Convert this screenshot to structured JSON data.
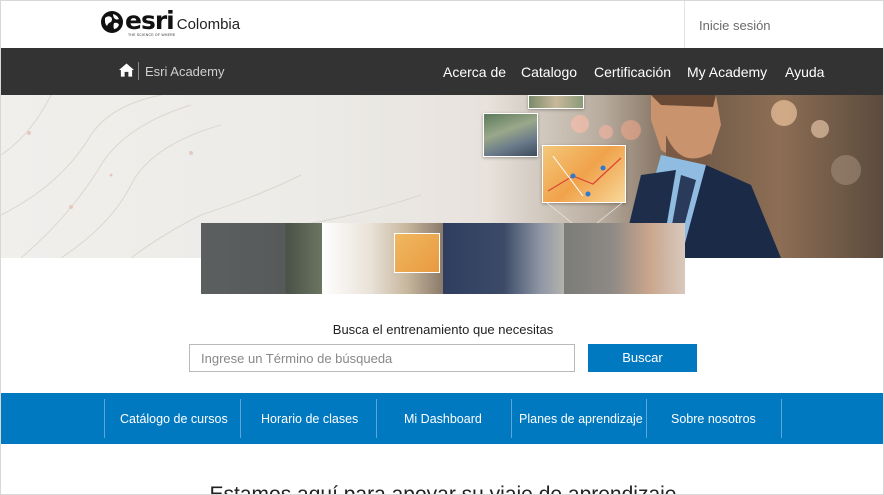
{
  "brand": {
    "logo_word": "esri",
    "logo_tagline": "THE SCIENCE OF WHERE",
    "country": "Colombia",
    "login": "Inicie sesión"
  },
  "topnav": {
    "academy_label": "Esri Academy",
    "items": [
      {
        "label": "Acerca de"
      },
      {
        "label": "Catalogo"
      },
      {
        "label": "Certificación"
      },
      {
        "label": "My Academy"
      },
      {
        "label": "Ayuda"
      }
    ]
  },
  "search": {
    "title": "Busca el entrenamiento que necesitas",
    "placeholder": "Ingrese un Término de búsqueda",
    "button": "Buscar"
  },
  "subnav": {
    "items": [
      {
        "label": "Catálogo de cursos"
      },
      {
        "label": "Horario de clases"
      },
      {
        "label": "Mi Dashboard"
      },
      {
        "label": "Planes de aprendizaje"
      },
      {
        "label": "Sobre nosotros"
      }
    ]
  },
  "content": {
    "heading": "Estamos aquí para apoyar su viaje de aprendizaje"
  },
  "colors": {
    "darknav": "#333333",
    "accent_blue": "#0079c1"
  }
}
